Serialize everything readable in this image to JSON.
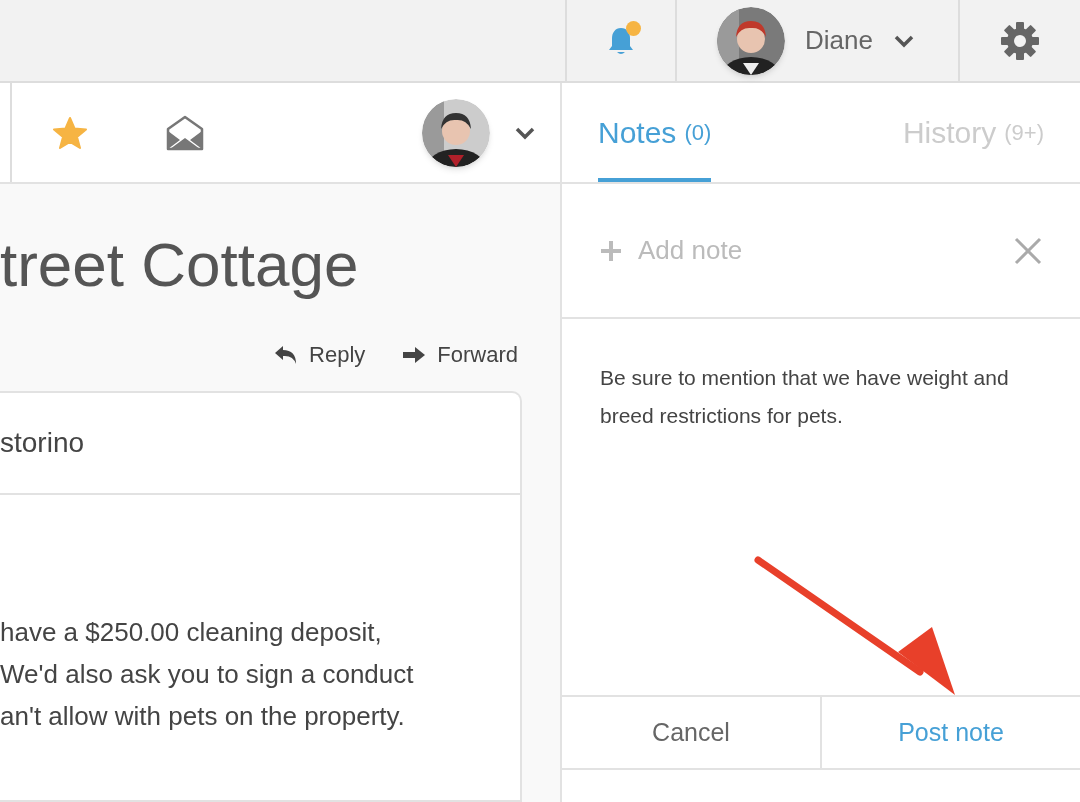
{
  "top_bar": {
    "notification": {
      "unread": true
    },
    "user": {
      "name": "Diane"
    }
  },
  "toolbar": {
    "starred": true
  },
  "message": {
    "title": "treet Cottage",
    "actions": [
      {
        "label": "Reply",
        "kind": "reply"
      },
      {
        "label": "Forward",
        "kind": "forward"
      }
    ],
    "sender": "storino",
    "body_lines": [
      "have a $250.00 cleaning deposit,",
      "We'd also ask you to sign a conduct",
      "an't allow with pets on the property."
    ]
  },
  "notes_panel": {
    "tabs": [
      {
        "label": "Notes",
        "count": "(0)",
        "selected": true
      },
      {
        "label": "History",
        "count": "(9+)",
        "selected": false
      }
    ],
    "add_note": "Add note",
    "note": {
      "value": "Be sure to mention that we have weight and breed restrictions for pets."
    },
    "buttons": [
      {
        "label": "Cancel",
        "kind": "cancel"
      },
      {
        "label": "Post note",
        "kind": "primary"
      }
    ]
  }
}
